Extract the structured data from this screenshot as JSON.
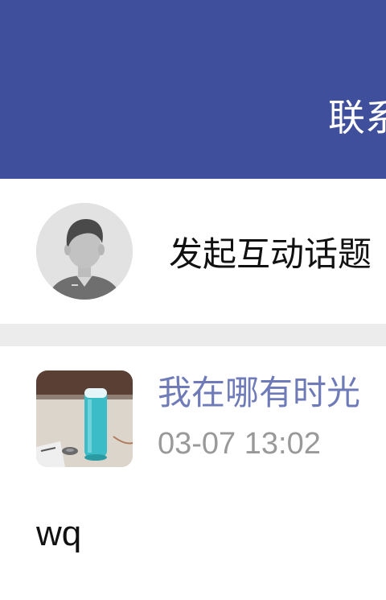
{
  "header": {
    "title": "联系",
    "background": "#3f4f9b"
  },
  "compose": {
    "avatar_icon": "default-user-avatar-icon",
    "label": "发起互动话题"
  },
  "posts": [
    {
      "avatar_icon": "thermos-photo-avatar",
      "author": "我在哪有时光",
      "time": "03-07 13:02",
      "content": "wq"
    }
  ],
  "colors": {
    "author_link": "#6e7bb8",
    "timestamp": "#999999",
    "divider": "#ececec"
  }
}
